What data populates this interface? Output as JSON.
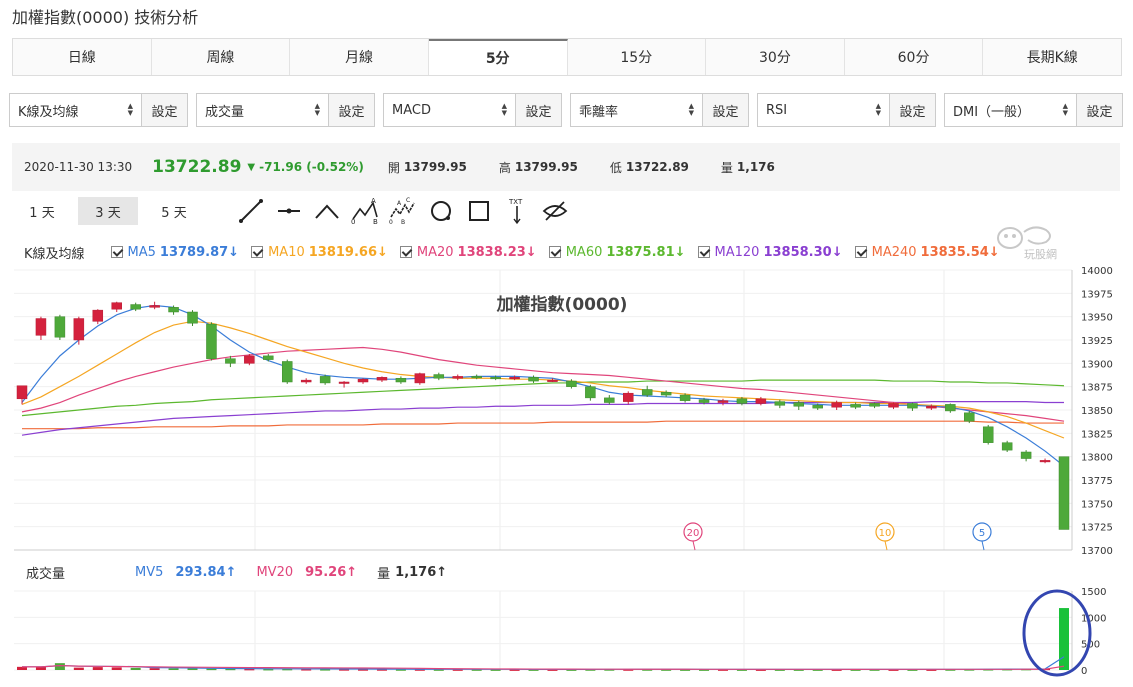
{
  "page": {
    "title": "加權指數(0000) 技術分析"
  },
  "tabs": [
    "日線",
    "周線",
    "月線",
    "5分",
    "15分",
    "30分",
    "60分",
    "長期K線"
  ],
  "active_tab": "5分",
  "selectors": [
    {
      "label": "K線及均線",
      "button": "設定"
    },
    {
      "label": "成交量",
      "button": "設定"
    },
    {
      "label": "MACD",
      "button": "設定"
    },
    {
      "label": "乖離率",
      "button": "設定"
    },
    {
      "label": "RSI",
      "button": "設定"
    },
    {
      "label": "DMI（一般）",
      "button": "設定"
    }
  ],
  "quote": {
    "time": "2020-11-30 13:30",
    "price": "13722.89",
    "change": "-71.96 (-0.52%)",
    "open_label": "開",
    "open": "13799.95",
    "high_label": "高",
    "high": "13799.95",
    "low_label": "低",
    "low": "13722.89",
    "vol_label": "量",
    "vol": "1,176"
  },
  "ranges": [
    "1 天",
    "3 天",
    "5 天"
  ],
  "active_range": "3 天",
  "tools": [
    "line-tool-icon",
    "horizontal-line-icon",
    "angle-icon",
    "abc-pattern-icon",
    "abcd-pattern-icon",
    "circle-icon",
    "rectangle-icon",
    "text-tool-icon",
    "hide-icon"
  ],
  "watermark": "玩股網",
  "legend": {
    "label": "K線及均線",
    "items": [
      {
        "name": "MA5",
        "value": "13789.87↓",
        "color": "#3b7dd8"
      },
      {
        "name": "MA10",
        "value": "13819.66↓",
        "color": "#f5a623"
      },
      {
        "name": "MA20",
        "value": "13838.23↓",
        "color": "#e0457b"
      },
      {
        "name": "MA60",
        "value": "13875.81↓",
        "color": "#5cb82f"
      },
      {
        "name": "MA120",
        "value": "13858.30↓",
        "color": "#8a3fd1"
      },
      {
        "name": "MA240",
        "value": "13835.54↓",
        "color": "#f06c3b"
      }
    ]
  },
  "chart_data": {
    "type": "candlestick",
    "title": "加權指數(0000)",
    "ylim": [
      13700,
      14000
    ],
    "yticks": [
      "14000",
      "13975",
      "13950",
      "13925",
      "13900",
      "13875",
      "13850",
      "13825",
      "13800",
      "13775",
      "13750",
      "13725",
      "13700"
    ],
    "markers": [
      {
        "label": "20",
        "color": "#e0457b"
      },
      {
        "label": "10",
        "color": "#f5a623"
      },
      {
        "label": "5",
        "color": "#3b7dd8"
      }
    ],
    "candles": [
      [
        13862,
        13876,
        13856,
        13875
      ],
      [
        13930,
        13948,
        13925,
        13950
      ],
      [
        13950,
        13928,
        13925,
        13952
      ],
      [
        13925,
        13948,
        13920,
        13950
      ],
      [
        13945,
        13957,
        13942,
        13958
      ],
      [
        13958,
        13965,
        13955,
        13966
      ],
      [
        13963,
        13958,
        13956,
        13965
      ],
      [
        13960,
        13962,
        13958,
        13966
      ],
      [
        13960,
        13955,
        13952,
        13962
      ],
      [
        13955,
        13943,
        13940,
        13957
      ],
      [
        13942,
        13905,
        13903,
        13944
      ],
      [
        13905,
        13900,
        13896,
        13908
      ],
      [
        13900,
        13908,
        13898,
        13910
      ],
      [
        13908,
        13904,
        13902,
        13910
      ],
      [
        13902,
        13880,
        13878,
        13904
      ],
      [
        13880,
        13882,
        13878,
        13884
      ],
      [
        13886,
        13879,
        13877,
        13888
      ],
      [
        13879,
        13880,
        13874,
        13881
      ],
      [
        13880,
        13883,
        13878,
        13884
      ],
      [
        13882,
        13885,
        13880,
        13886
      ],
      [
        13884,
        13880,
        13878,
        13886
      ],
      [
        13879,
        13889,
        13877,
        13890
      ],
      [
        13888,
        13884,
        13882,
        13890
      ],
      [
        13884,
        13886,
        13882,
        13888
      ],
      [
        13886,
        13885,
        13883,
        13888
      ],
      [
        13885,
        13884,
        13882,
        13887
      ],
      [
        13884,
        13885,
        13882,
        13887
      ],
      [
        13885,
        13881,
        13879,
        13887
      ],
      [
        13882,
        13882,
        13880,
        13884
      ],
      [
        13881,
        13875,
        13873,
        13883
      ],
      [
        13875,
        13863,
        13860,
        13877
      ],
      [
        13863,
        13858,
        13856,
        13866
      ],
      [
        13859,
        13868,
        13856,
        13870
      ],
      [
        13872,
        13866,
        13864,
        13876
      ],
      [
        13869,
        13866,
        13864,
        13871
      ],
      [
        13866,
        13860,
        13858,
        13868
      ],
      [
        13861,
        13858,
        13856,
        13863
      ],
      [
        13858,
        13860,
        13855,
        13862
      ],
      [
        13862,
        13857,
        13855,
        13864
      ],
      [
        13857,
        13862,
        13855,
        13864
      ],
      [
        13859,
        13855,
        13852,
        13861
      ],
      [
        13858,
        13854,
        13850,
        13860
      ],
      [
        13855,
        13852,
        13850,
        13857
      ],
      [
        13853,
        13858,
        13850,
        13860
      ],
      [
        13856,
        13853,
        13851,
        13858
      ],
      [
        13857,
        13854,
        13852,
        13858
      ],
      [
        13853,
        13857,
        13851,
        13858
      ],
      [
        13857,
        13852,
        13849,
        13858
      ],
      [
        13852,
        13854,
        13850,
        13856
      ],
      [
        13856,
        13849,
        13847,
        13857
      ],
      [
        13847,
        13838,
        13836,
        13849
      ],
      [
        13832,
        13815,
        13813,
        13834
      ],
      [
        13815,
        13807,
        13805,
        13817
      ],
      [
        13805,
        13798,
        13795,
        13807
      ],
      [
        13796,
        13796,
        13793,
        13798
      ],
      [
        13800,
        13722,
        13722,
        13800
      ]
    ],
    "ma": {
      "MA5": [
        13858,
        13885,
        13908,
        13925,
        13940,
        13952,
        13959,
        13962,
        13960,
        13952,
        13940,
        13925,
        13912,
        13903,
        13896,
        13890,
        13887,
        13885,
        13884,
        13883,
        13883,
        13884,
        13885,
        13885,
        13886,
        13886,
        13886,
        13885,
        13884,
        13880,
        13875,
        13869,
        13866,
        13865,
        13864,
        13863,
        13862,
        13860,
        13859,
        13859,
        13858,
        13857,
        13856,
        13855,
        13855,
        13855,
        13855,
        13855,
        13854,
        13853,
        13849,
        13842,
        13832,
        13820,
        13806,
        13790
      ],
      "MA10": [
        13856,
        13864,
        13875,
        13886,
        13898,
        13910,
        13922,
        13933,
        13941,
        13945,
        13943,
        13938,
        13932,
        13925,
        13918,
        13912,
        13906,
        13900,
        13895,
        13891,
        13888,
        13886,
        13885,
        13884,
        13884,
        13884,
        13883,
        13883,
        13882,
        13881,
        13879,
        13876,
        13874,
        13871,
        13869,
        13867,
        13865,
        13864,
        13863,
        13862,
        13861,
        13860,
        13859,
        13858,
        13858,
        13857,
        13857,
        13856,
        13855,
        13854,
        13852,
        13848,
        13843,
        13836,
        13828,
        13820
      ],
      "MA20": [
        13848,
        13852,
        13858,
        13866,
        13873,
        13880,
        13886,
        13891,
        13896,
        13900,
        13904,
        13907,
        13909,
        13911,
        13913,
        13914,
        13915,
        13916,
        13917,
        13915,
        13912,
        13908,
        13904,
        13901,
        13898,
        13896,
        13894,
        13892,
        13890,
        13889,
        13888,
        13887,
        13885,
        13883,
        13881,
        13879,
        13877,
        13875,
        13873,
        13872,
        13870,
        13868,
        13866,
        13864,
        13862,
        13860,
        13858,
        13856,
        13854,
        13852,
        13850,
        13848,
        13846,
        13844,
        13841,
        13838
      ],
      "MA60": [
        13844,
        13846,
        13848,
        13850,
        13852,
        13854,
        13855,
        13857,
        13858,
        13859,
        13861,
        13862,
        13863,
        13864,
        13865,
        13866,
        13867,
        13868,
        13869,
        13870,
        13871,
        13872,
        13873,
        13874,
        13875,
        13876,
        13877,
        13878,
        13879,
        13879,
        13880,
        13880,
        13880,
        13881,
        13881,
        13881,
        13881,
        13881,
        13881,
        13882,
        13882,
        13882,
        13882,
        13882,
        13882,
        13882,
        13881,
        13881,
        13881,
        13880,
        13880,
        13879,
        13879,
        13878,
        13877,
        13876
      ],
      "MA120": [
        13823,
        13826,
        13829,
        13831,
        13833,
        13835,
        13837,
        13839,
        13841,
        13842,
        13843,
        13844,
        13845,
        13846,
        13847,
        13848,
        13849,
        13849,
        13850,
        13851,
        13851,
        13852,
        13852,
        13853,
        13853,
        13854,
        13854,
        13855,
        13855,
        13855,
        13856,
        13856,
        13856,
        13857,
        13857,
        13857,
        13857,
        13857,
        13857,
        13857,
        13858,
        13858,
        13858,
        13858,
        13858,
        13858,
        13858,
        13858,
        13859,
        13859,
        13859,
        13859,
        13859,
        13859,
        13858,
        13858
      ],
      "MA240": [
        13830,
        13830,
        13830,
        13830,
        13831,
        13831,
        13831,
        13832,
        13832,
        13832,
        13832,
        13833,
        13833,
        13833,
        13834,
        13834,
        13834,
        13834,
        13834,
        13835,
        13835,
        13835,
        13835,
        13836,
        13836,
        13836,
        13836,
        13836,
        13837,
        13837,
        13837,
        13837,
        13837,
        13837,
        13838,
        13838,
        13838,
        13838,
        13838,
        13838,
        13838,
        13838,
        13838,
        13838,
        13838,
        13838,
        13838,
        13838,
        13838,
        13838,
        13838,
        13837,
        13837,
        13836,
        13836,
        13836
      ]
    },
    "volume": {
      "label": "成交量",
      "mv5_label": "MV5",
      "mv5": "293.84↑",
      "mv20_label": "MV20",
      "mv20": "95.26↑",
      "vol_label": "量",
      "vol": "1,176↑",
      "ylim": [
        0,
        1500
      ],
      "yticks": [
        "1500",
        "1000",
        "500",
        "0"
      ],
      "bars": [
        60,
        60,
        130,
        45,
        55,
        50,
        40,
        35,
        30,
        28,
        26,
        25,
        22,
        20,
        22,
        18,
        17,
        16,
        15,
        15,
        14,
        14,
        13,
        13,
        13,
        12,
        12,
        12,
        12,
        12,
        14,
        15,
        14,
        14,
        13,
        12,
        12,
        13,
        12,
        12,
        12,
        12,
        12,
        12,
        12,
        13,
        12,
        12,
        12,
        14,
        16,
        18,
        20,
        22,
        25,
        1176
      ]
    }
  }
}
